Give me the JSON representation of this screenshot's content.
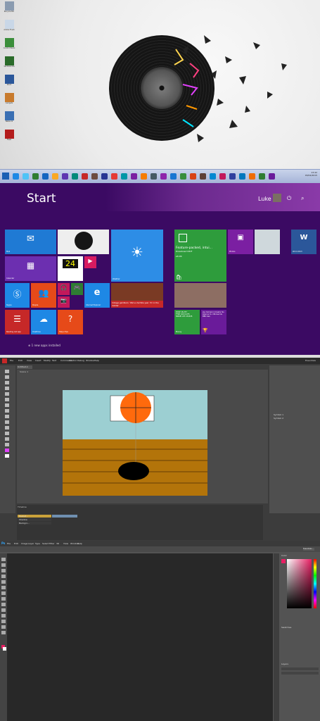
{
  "desktop": {
    "icons": [
      {
        "label": "Recycle Bin",
        "color": "#8a9bb0"
      },
      {
        "label": "Adobe Flash",
        "color": "#c9d7e7"
      },
      {
        "label": "Control Panel",
        "color": "#3b8e3b"
      },
      {
        "label": "Vectorworks",
        "color": "#2a6b2a"
      },
      {
        "label": "Word",
        "color": "#2b579a"
      },
      {
        "label": "Gadgets",
        "color": "#c87a2c"
      },
      {
        "label": "Network",
        "color": "#3a6fb3"
      },
      {
        "label": "Flash",
        "color": "#b31c1c"
      }
    ]
  },
  "taskbar": {
    "clock_time": "13:42",
    "clock_date": "03/02/2015",
    "app_colors": [
      "#1e88e5",
      "#4fc3f7",
      "#2e7d32",
      "#1565c0",
      "#f9a825",
      "#5e35b1",
      "#00897b",
      "#c62828",
      "#6d4c41",
      "#283593",
      "#e53935",
      "#0097a7",
      "#7b1fa2",
      "#f57c00",
      "#455a64",
      "#8e24aa",
      "#1976d2",
      "#388e3c",
      "#d84315",
      "#5d4037",
      "#0288d1",
      "#c2185b",
      "#303f9f",
      "#0277bd",
      "#ef6c00",
      "#2e7d32",
      "#6a1b9a"
    ]
  },
  "start": {
    "title": "Start",
    "user_name": "Luke",
    "new_apps_text": "1 new apps installed",
    "tiles": {
      "mail": "Mail",
      "calendar": "Calendar",
      "weather": "Weather",
      "skype": "Skype",
      "people": "People",
      "ie": "Internet Explorer",
      "reading_list": "Reading List app",
      "onedrive": "OneDrive",
      "help": "Help+Tips",
      "news_headline": "College gamblers: 'We'e a terrible year. I'm in the middle'",
      "store_title": "Feature-packed, intui...",
      "store_subtitle": "Drawboard PDF",
      "store_price": "£6.99",
      "photos": "Photos",
      "word": "Word 2013",
      "finance_lines": "DOW 18,257\nFTSE 100 6,975\nNIKKEI 225 18,826",
      "sport_text": "Joe Cameron breaks his silence to criticise his BBC ban",
      "money": "Money",
      "countdown": "24"
    }
  },
  "flash": {
    "menu": [
      "File",
      "Edit",
      "View",
      "Insert",
      "Modify",
      "Text",
      "Commands",
      "Control",
      "Debug",
      "Window",
      "Help"
    ],
    "doc_tab": "Untitled-1",
    "scene": "Scene 1",
    "timeline_label": "Timeline",
    "layers": [
      "Basket...",
      "Shadow",
      "Backgro..."
    ],
    "library_items": [
      "Symbol 1",
      "Symbol 2"
    ],
    "workspace": "Essentials"
  },
  "photoshop": {
    "logo": "Ps",
    "menu": [
      "File",
      "Edit",
      "Image",
      "Layer",
      "Type",
      "Select",
      "Filter",
      "3D",
      "View",
      "Window",
      "Help"
    ],
    "workspace": "Essentials",
    "color_panel": "Color",
    "swatches_panel": "Swatches",
    "layers_panel": "Layers"
  }
}
